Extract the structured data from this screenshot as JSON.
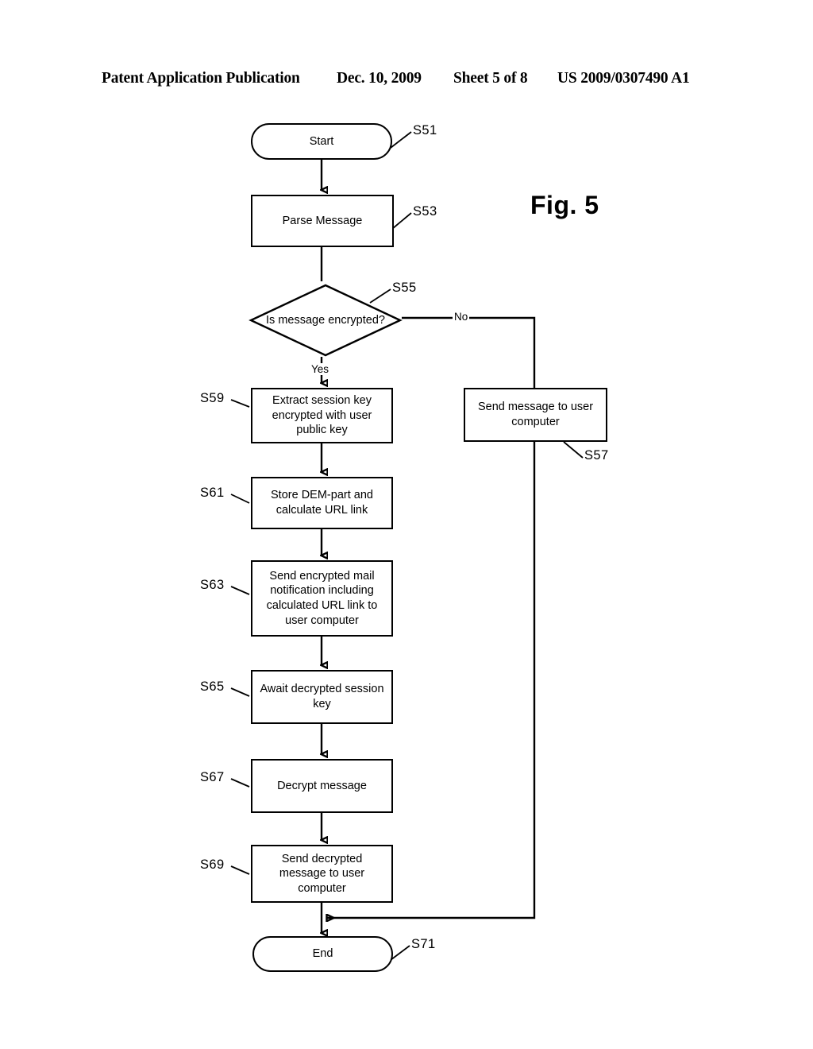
{
  "header": {
    "publication": "Patent Application Publication",
    "date": "Dec. 10, 2009",
    "sheet": "Sheet 5 of 8",
    "patent_number": "US 2009/0307490 A1"
  },
  "figure": {
    "label": "Fig. 5"
  },
  "flowchart": {
    "nodes": [
      {
        "id": "S51",
        "tag": "S51",
        "type": "terminal",
        "text": "Start"
      },
      {
        "id": "S53",
        "tag": "S53",
        "type": "process",
        "text": "Parse Message"
      },
      {
        "id": "S55",
        "tag": "S55",
        "type": "decision",
        "text": "Is message encrypted?"
      },
      {
        "id": "S57",
        "tag": "S57",
        "type": "process",
        "text": "Send message to user computer"
      },
      {
        "id": "S59",
        "tag": "S59",
        "type": "process",
        "text": "Extract session key encrypted with user public key"
      },
      {
        "id": "S61",
        "tag": "S61",
        "type": "process",
        "text": "Store DEM-part and calculate URL link"
      },
      {
        "id": "S63",
        "tag": "S63",
        "type": "process",
        "text": "Send encrypted mail notification including calculated URL link to user computer"
      },
      {
        "id": "S65",
        "tag": "S65",
        "type": "process",
        "text": "Await decrypted session key"
      },
      {
        "id": "S67",
        "tag": "S67",
        "type": "process",
        "text": "Decrypt message"
      },
      {
        "id": "S69",
        "tag": "S69",
        "type": "process",
        "text": "Send decrypted message to user computer"
      },
      {
        "id": "S71",
        "tag": "S71",
        "type": "terminal",
        "text": "End"
      }
    ],
    "branch_labels": {
      "yes": "Yes",
      "no": "No"
    },
    "colors": {
      "stroke": "#000000",
      "background": "#ffffff"
    }
  }
}
